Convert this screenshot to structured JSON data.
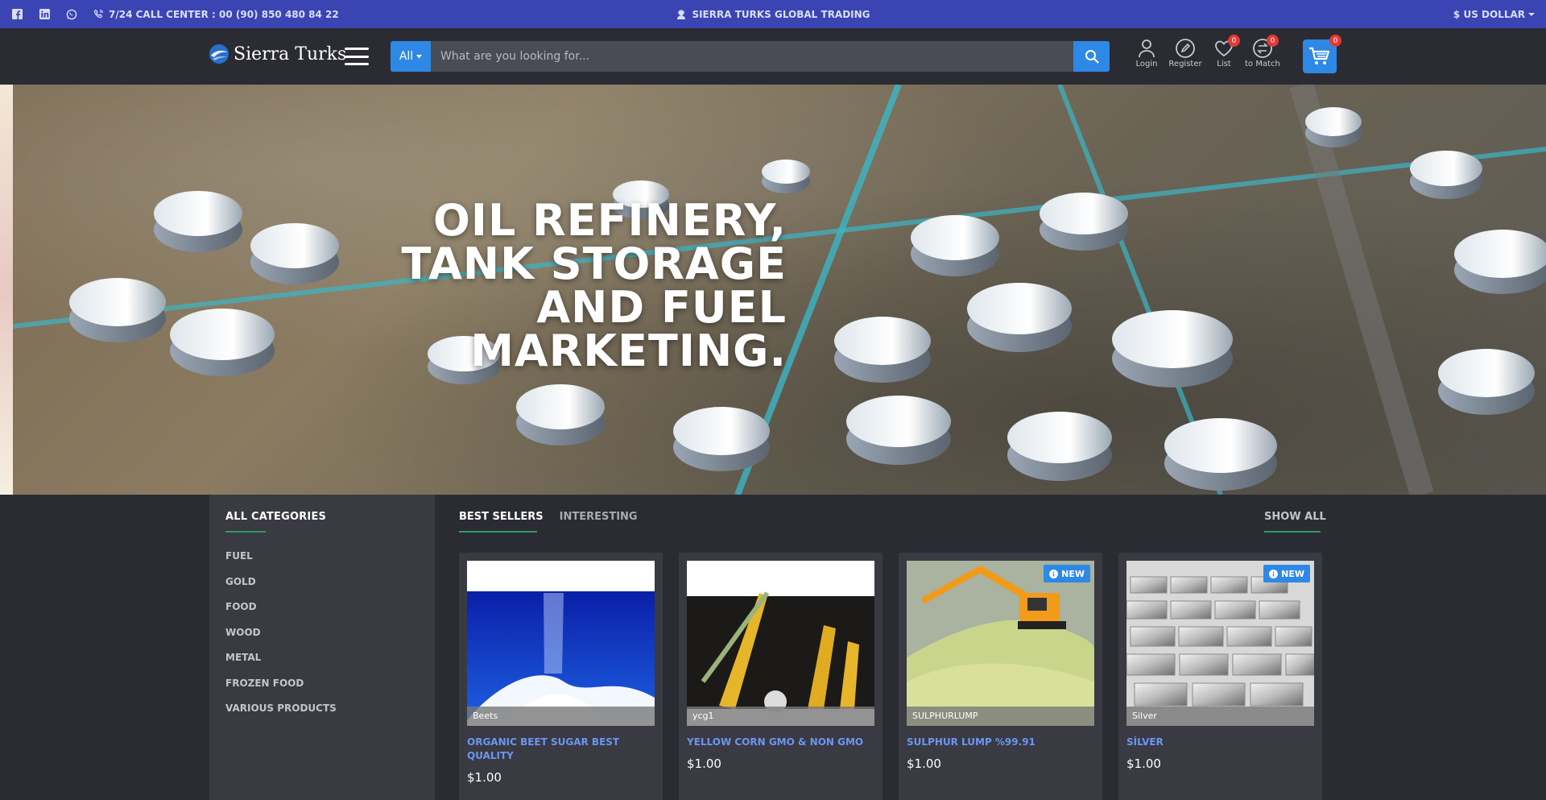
{
  "topbar": {
    "call_center": "7/24 CALL CENTER : 00 (90) 850 480 84 22",
    "company": "SIERRA TURKS GLOBAL TRADING",
    "currency": "$ US DOLLAR",
    "social_icons": [
      "facebook-icon",
      "linkedin-icon",
      "whatsapp-icon"
    ]
  },
  "header": {
    "logo_text": "Sierra Turks",
    "search_category": "All",
    "search_placeholder": "What are you looking for...",
    "icons": [
      {
        "name": "login",
        "label": "Login"
      },
      {
        "name": "register",
        "label": "Register"
      },
      {
        "name": "list",
        "label": "List",
        "count": "0"
      },
      {
        "name": "match",
        "label": "to Match",
        "count": "0"
      }
    ],
    "cart_count": "0"
  },
  "hero": {
    "line1": "OIL REFINERY,",
    "line2": "TANK STORAGE",
    "line3": "AND FUEL",
    "line4": "MARKETING."
  },
  "sidebar": {
    "title": "ALL CATEGORIES",
    "items": [
      "FUEL",
      "GOLD",
      "FOOD",
      "WOOD",
      "METAL",
      "FROZEN FOOD",
      "VARIOUS PRODUCTS"
    ]
  },
  "tabs": {
    "best_sellers": "BEST SELLERS",
    "interesting": "INTERESTING",
    "show_all": "SHOW ALL"
  },
  "products": [
    {
      "caption": "Beets",
      "name": "ORGANIC BEET SUGAR BEST QUALITY",
      "price": "$1.00",
      "badge": ""
    },
    {
      "caption": "ycg1",
      "name": "YELLOW CORN GMO & NON GMO",
      "price": "$1.00",
      "badge": ""
    },
    {
      "caption": "SULPHURLUMP",
      "name": "SULPHUR LUMP %99.91",
      "price": "$1.00",
      "badge": "NEW"
    },
    {
      "caption": "Silver",
      "name": "SİLVER",
      "price": "$1.00",
      "badge": "NEW"
    }
  ]
}
